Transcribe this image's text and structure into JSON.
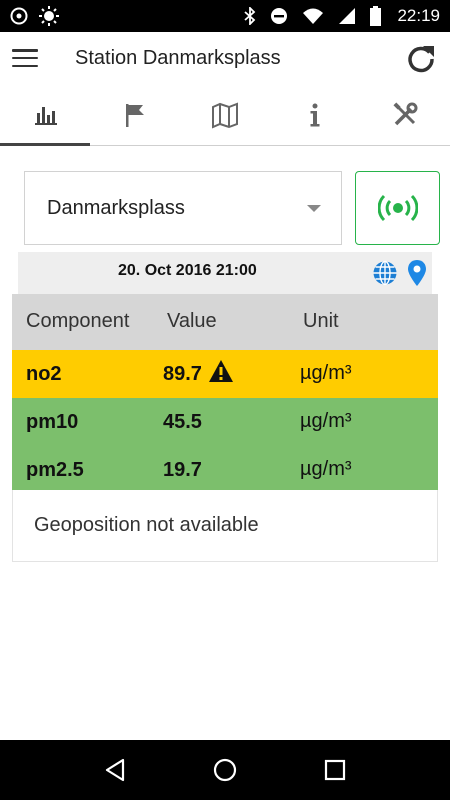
{
  "status_bar": {
    "time": "22:19",
    "left_icons": [
      "gear-icon",
      "brightness-icon"
    ],
    "right_icons": [
      "bluetooth-icon",
      "do-not-disturb-icon",
      "wifi-icon",
      "signal-icon",
      "battery-icon"
    ]
  },
  "app_bar": {
    "title": "Station Danmarksplass",
    "menu_icon": "menu-icon",
    "refresh_icon": "refresh-icon"
  },
  "tabs": [
    {
      "icon": "bar-chart-icon",
      "active": true
    },
    {
      "icon": "flag-icon",
      "active": false
    },
    {
      "icon": "map-icon",
      "active": false
    },
    {
      "icon": "info-icon",
      "active": false
    },
    {
      "icon": "tools-icon",
      "active": false
    }
  ],
  "station_select": {
    "selected": "Danmarksplass"
  },
  "live_button": {
    "icon": "live-signal-icon",
    "color": "#27b34a"
  },
  "date": {
    "text": "20. Oct 2016 21:00",
    "globe_icon": "globe-icon",
    "pin_icon": "location-pin-icon"
  },
  "table": {
    "headers": [
      "Component",
      "Value",
      "Unit"
    ],
    "rows": [
      {
        "component": "no2",
        "value": "89.7",
        "unit": "µg/m³",
        "color": "#ffcc00",
        "warning": true
      },
      {
        "component": "pm10",
        "value": "45.5",
        "unit": "µg/m³",
        "color": "#7cbf6c",
        "warning": false
      },
      {
        "component": "pm2.5",
        "value": "19.7",
        "unit": "µg/m³",
        "color": "#7cbf6c",
        "warning": false
      }
    ]
  },
  "geoposition": "Geoposition not available",
  "nav_bar": {
    "icons": [
      "back-icon",
      "home-icon",
      "recents-icon"
    ]
  }
}
